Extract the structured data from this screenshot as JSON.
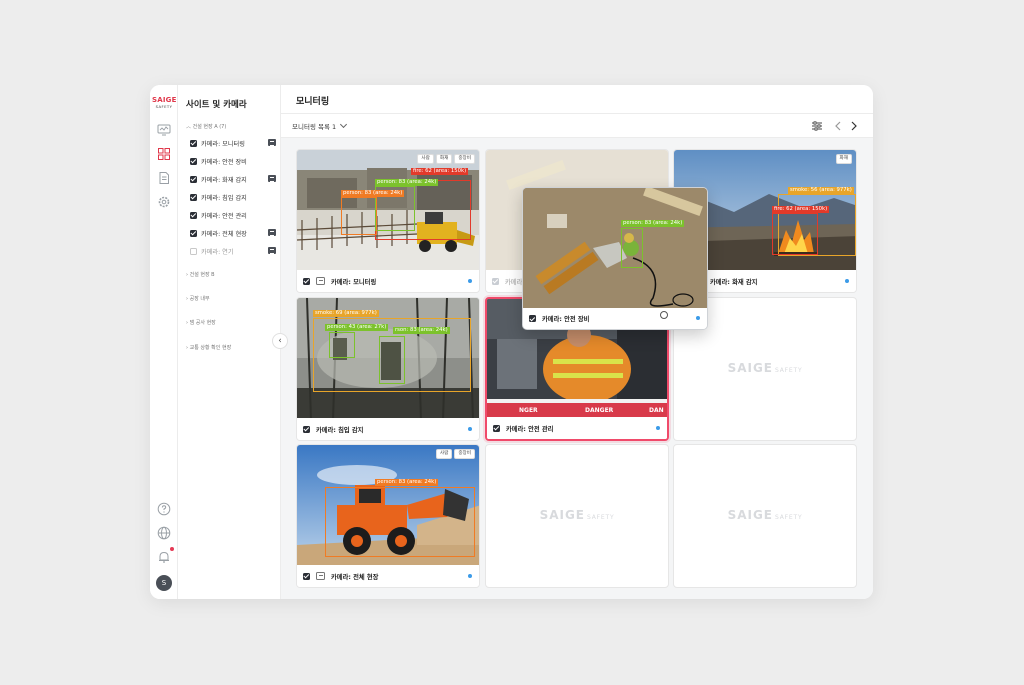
{
  "brand": {
    "line1": "SAIGE",
    "line2": "SAFETY"
  },
  "sidebar": {
    "title": "사이트 및 카메라",
    "groups": [
      {
        "label": "건설 현장 A (7)",
        "expanded": true
      },
      {
        "label": "건설 현장 B"
      },
      {
        "label": "공장 내부"
      },
      {
        "label": "댐 공사 현장"
      },
      {
        "label": "교통 상황 확인 현장"
      }
    ],
    "cameras": [
      {
        "label": "카메라: 모니터링",
        "checked": true,
        "stream": true
      },
      {
        "label": "카메라: 안전 장비",
        "checked": true,
        "stream": false
      },
      {
        "label": "카메라: 화재 감지",
        "checked": true,
        "stream": true
      },
      {
        "label": "카메라: 침입 감지",
        "checked": true,
        "stream": false
      },
      {
        "label": "카메라: 안전 관리",
        "checked": true,
        "stream": false
      },
      {
        "label": "카메라: 전체 현장",
        "checked": true,
        "stream": true
      },
      {
        "label": "카메라: 연기",
        "checked": false,
        "stream": true
      }
    ]
  },
  "main": {
    "title": "모니터링",
    "selector": "모니터링 목록 1"
  },
  "tiles": {
    "monitoring": {
      "label": "카메라: 모니터링",
      "badges": [
        "사람",
        "화재",
        "중장비"
      ],
      "detections": [
        "fire: 62 (area: 150k)",
        "person: 83 (area: 24k)",
        "person: 83 (area: 24k)"
      ]
    },
    "safety_gear_bg": {
      "label": "카메라: 안전 장비"
    },
    "fire": {
      "label": "카메라: 화재 감지",
      "badges": [
        "화재"
      ],
      "detections": [
        "smoke: 56 (area: 977k)",
        "fire: 62 (area: 150k)"
      ]
    },
    "intrusion": {
      "label": "카메라: 침입 감지",
      "detections": [
        "smoke: 69 (area: 977k)",
        "person: 43 (area: 27k)",
        "rson: 83 (area: 24k)"
      ]
    },
    "safety_mgmt": {
      "label": "카메라: 안전 관리",
      "signs": [
        "NGER",
        "DANGER",
        "DAN"
      ]
    },
    "site": {
      "label": "카메라: 전체 현장",
      "badges": [
        "사람",
        "중장비"
      ],
      "detections": [
        "person: 83 (area: 24k)"
      ]
    },
    "popup": {
      "label": "카메라: 안전 장비",
      "detections": [
        "person: 83 (area: 24k)"
      ]
    },
    "empty_watermark": {
      "main": "SAIGE",
      "sub": "SAFETY"
    }
  },
  "user": {
    "avatar": "S"
  }
}
